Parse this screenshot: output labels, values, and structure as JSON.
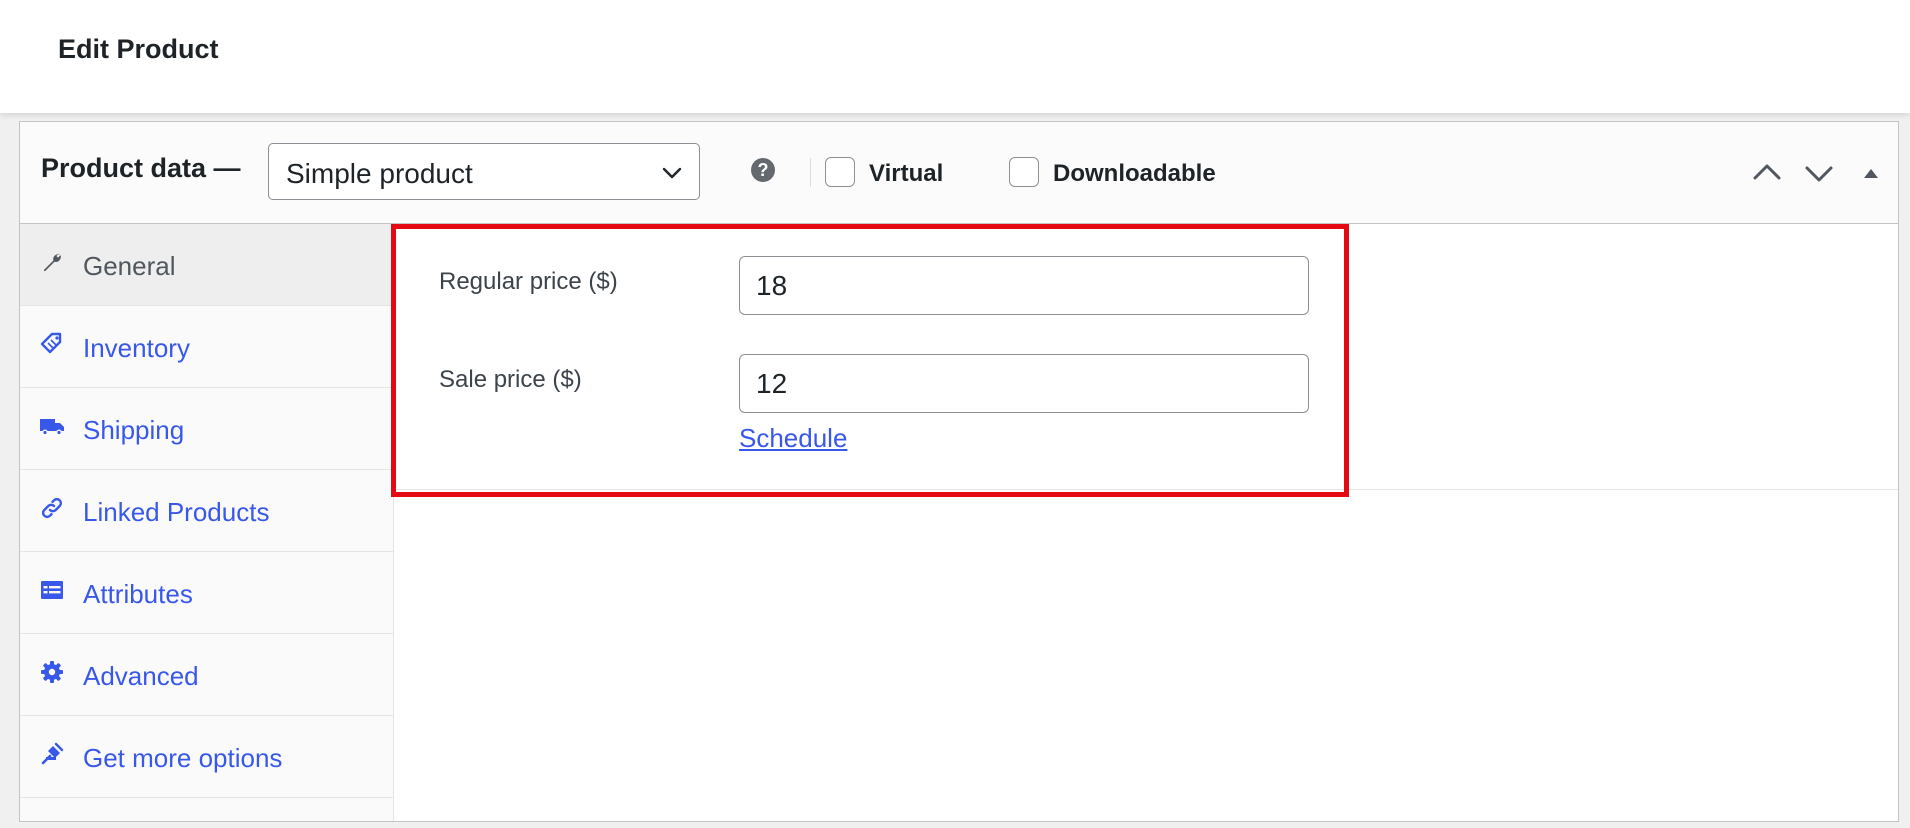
{
  "header": {
    "title": "Edit Product"
  },
  "product_data": {
    "title": "Product data —",
    "type_select": {
      "value": "Simple product"
    },
    "help_icon": "question-circle-icon",
    "checkboxes": [
      {
        "label": "Virtual",
        "checked": false
      },
      {
        "label": "Downloadable",
        "checked": false
      }
    ],
    "controls": [
      "move-up-icon",
      "move-down-icon",
      "collapse-icon"
    ]
  },
  "tabs": [
    {
      "label": "General",
      "icon": "wrench-icon",
      "active": true
    },
    {
      "label": "Inventory",
      "icon": "tag-icon",
      "active": false
    },
    {
      "label": "Shipping",
      "icon": "truck-icon",
      "active": false
    },
    {
      "label": "Linked Products",
      "icon": "link-icon",
      "active": false
    },
    {
      "label": "Attributes",
      "icon": "list-table-icon",
      "active": false
    },
    {
      "label": "Advanced",
      "icon": "gear-icon",
      "active": false
    },
    {
      "label": "Get more options",
      "icon": "plugin-icon",
      "active": false
    }
  ],
  "general": {
    "regular_price": {
      "label": "Regular price ($)",
      "value": "18"
    },
    "sale_price": {
      "label": "Sale price ($)",
      "value": "12"
    },
    "schedule_link": "Schedule"
  },
  "colors": {
    "link": "#3858e9",
    "highlight": "#e50913",
    "border": "#c3c4c7"
  }
}
